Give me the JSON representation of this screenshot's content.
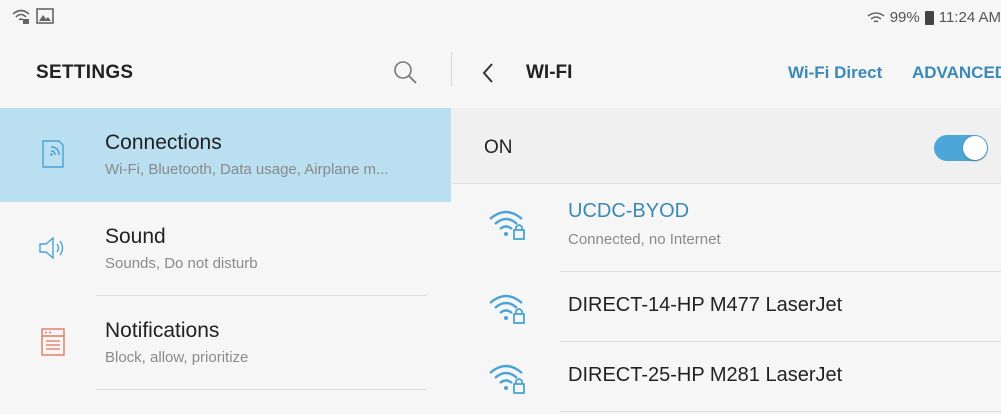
{
  "status_bar": {
    "battery": "99%",
    "time": "11:24 AM"
  },
  "settings": {
    "title": "SETTINGS",
    "items": [
      {
        "title": "Connections",
        "subtitle": "Wi-Fi, Bluetooth, Data usage, Airplane m...",
        "icon": "connections-icon",
        "selected": true
      },
      {
        "title": "Sound",
        "subtitle": "Sounds, Do not disturb",
        "icon": "sound-icon",
        "selected": false
      },
      {
        "title": "Notifications",
        "subtitle": "Block, allow, prioritize",
        "icon": "notifications-icon",
        "selected": false
      }
    ]
  },
  "wifi": {
    "title": "WI-FI",
    "wifi_direct": "Wi-Fi Direct",
    "advanced": "ADVANCED",
    "toggle_label": "ON",
    "enabled": true,
    "networks": [
      {
        "name": "UCDC-BYOD",
        "status": "Connected, no Internet",
        "secured": true
      },
      {
        "name": "DIRECT-14-HP M477 LaserJet",
        "status": "",
        "secured": true
      },
      {
        "name": "DIRECT-25-HP M281 LaserJet",
        "status": "",
        "secured": true
      }
    ]
  },
  "colors": {
    "accent": "#3a89b8",
    "selected_bg": "#b9dff0",
    "wifi_icon": "#4aa3d6",
    "notifications_icon": "#e07a62"
  }
}
